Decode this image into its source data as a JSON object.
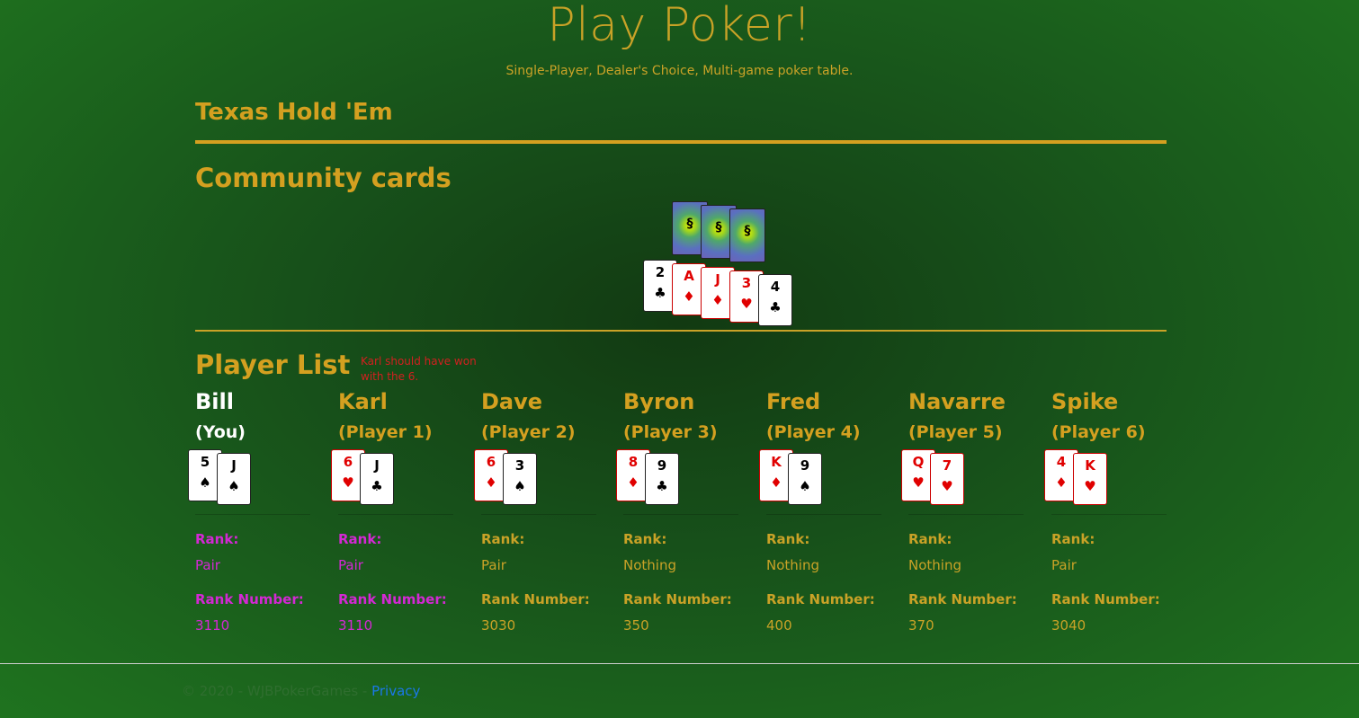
{
  "header": {
    "title": "Play Poker!",
    "subtitle": "Single-Player, Dealer's Choice, Multi-game poker table."
  },
  "game": {
    "name": "Texas Hold 'Em"
  },
  "community": {
    "title": "Community cards",
    "face_down": [
      {
        "symbol": "§"
      },
      {
        "symbol": "§"
      },
      {
        "symbol": "§"
      }
    ],
    "cards": [
      {
        "rank": "2",
        "suit": "♣",
        "color": "black"
      },
      {
        "rank": "A",
        "suit": "♦",
        "color": "red"
      },
      {
        "rank": "J",
        "suit": "♦",
        "color": "red"
      },
      {
        "rank": "3",
        "suit": "♥",
        "color": "red"
      },
      {
        "rank": "4",
        "suit": "♣",
        "color": "black"
      }
    ]
  },
  "player_list": {
    "title": "Player List",
    "note": "Karl should have won with the 6.",
    "rank_label": "Rank:",
    "rank_number_label": "Rank Number:",
    "players": [
      {
        "name": "Bill",
        "role": "(You)",
        "rank": "Pair",
        "rank_number": "3110",
        "cards": [
          {
            "rank": "5",
            "suit": "♠",
            "color": "black"
          },
          {
            "rank": "J",
            "suit": "♠",
            "color": "black"
          }
        ]
      },
      {
        "name": "Karl",
        "role": "(Player 1)",
        "rank": "Pair",
        "rank_number": "3110",
        "cards": [
          {
            "rank": "6",
            "suit": "♥",
            "color": "red"
          },
          {
            "rank": "J",
            "suit": "♣",
            "color": "black"
          }
        ]
      },
      {
        "name": "Dave",
        "role": "(Player 2)",
        "rank": "Pair",
        "rank_number": "3030",
        "cards": [
          {
            "rank": "6",
            "suit": "♦",
            "color": "red"
          },
          {
            "rank": "3",
            "suit": "♠",
            "color": "black"
          }
        ]
      },
      {
        "name": "Byron",
        "role": "(Player 3)",
        "rank": "Nothing",
        "rank_number": "350",
        "cards": [
          {
            "rank": "8",
            "suit": "♦",
            "color": "red"
          },
          {
            "rank": "9",
            "suit": "♣",
            "color": "black"
          }
        ]
      },
      {
        "name": "Fred",
        "role": "(Player 4)",
        "rank": "Nothing",
        "rank_number": "400",
        "cards": [
          {
            "rank": "K",
            "suit": "♦",
            "color": "red"
          },
          {
            "rank": "9",
            "suit": "♠",
            "color": "black"
          }
        ]
      },
      {
        "name": "Navarre",
        "role": "(Player 5)",
        "rank": "Nothing",
        "rank_number": "370",
        "cards": [
          {
            "rank": "Q",
            "suit": "♥",
            "color": "red"
          },
          {
            "rank": "7",
            "suit": "♥",
            "color": "red"
          }
        ]
      },
      {
        "name": "Spike",
        "role": "(Player 6)",
        "rank": "Pair",
        "rank_number": "3040",
        "cards": [
          {
            "rank": "4",
            "suit": "♦",
            "color": "red"
          },
          {
            "rank": "K",
            "suit": "♥",
            "color": "red"
          }
        ]
      }
    ]
  },
  "footer": {
    "copyright": "© 2020 - WJBPokerGames - ",
    "privacy_label": "Privacy"
  },
  "colors": {
    "accent": "#d4a020",
    "winner_highlight": "#d428d4",
    "red_suit": "#e00000"
  }
}
